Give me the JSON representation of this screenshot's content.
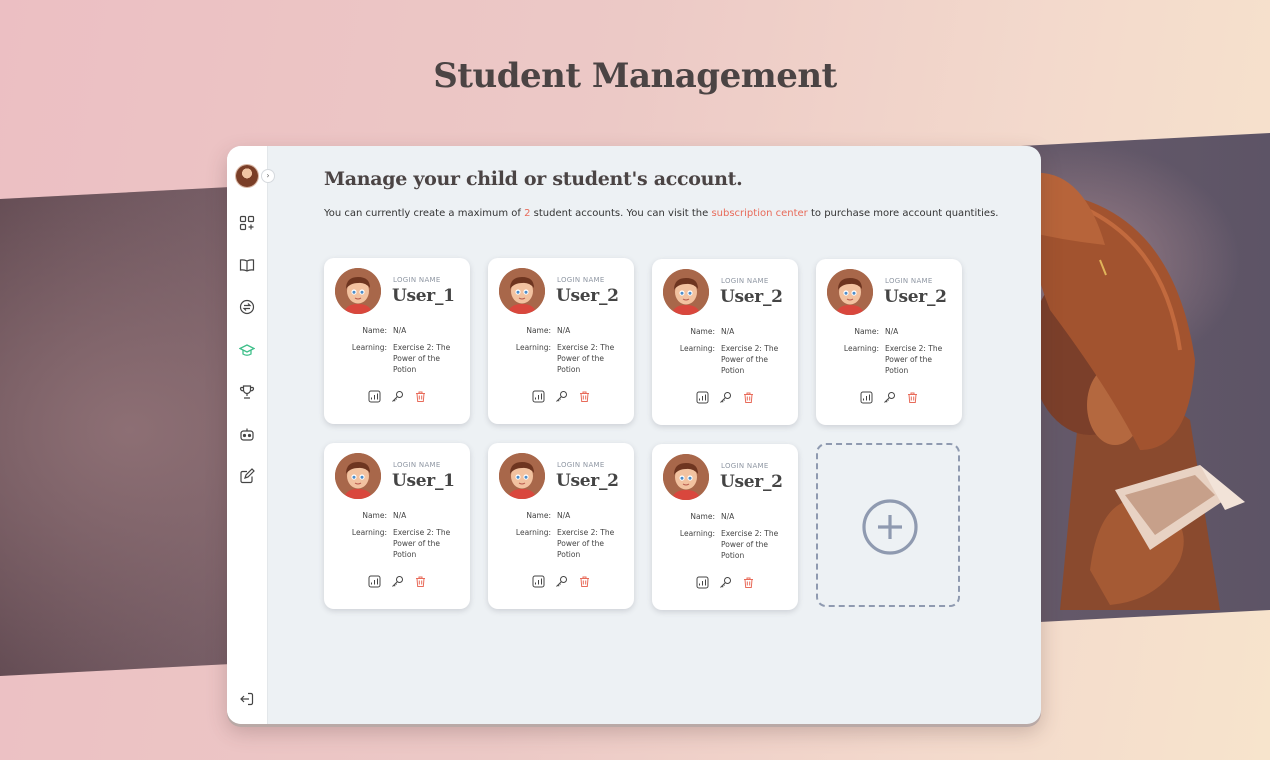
{
  "page": {
    "title": "Student Management"
  },
  "panel": {
    "heading": "Manage your child or student's account.",
    "notice_prefix": "You can currently create a maximum of ",
    "max_accounts": "2",
    "notice_mid": " student accounts. You can visit the ",
    "subscription_link": "subscription center",
    "notice_suffix": " to purchase more account quantities."
  },
  "sidebar": {
    "toggle_glyph": "›",
    "items": [
      {
        "name": "apps-add-icon",
        "active": false
      },
      {
        "name": "book-icon",
        "active": false
      },
      {
        "name": "exchange-icon",
        "active": false
      },
      {
        "name": "graduation-cap-icon",
        "active": true
      },
      {
        "name": "trophy-icon",
        "active": false
      },
      {
        "name": "robot-icon",
        "active": false
      },
      {
        "name": "edit-icon",
        "active": false
      }
    ],
    "logout_icon": "logout-icon"
  },
  "colors": {
    "accent": "#e86b5a",
    "active_icon": "#3fbf8a",
    "icon": "#444444",
    "dashed_border": "#8f9ab0"
  },
  "cards": [
    {
      "login_label": "LOGIN NAME",
      "username": "User_1",
      "name_label": "Name:",
      "name": "N/A",
      "learning_label": "Learning:",
      "learning": "Exercise 2: The Power of the Potion"
    },
    {
      "login_label": "LOGIN NAME",
      "username": "User_2",
      "name_label": "Name:",
      "name": "N/A",
      "learning_label": "Learning:",
      "learning": "Exercise 2: The Power of the Potion"
    },
    {
      "login_label": "LOGIN NAME",
      "username": "User_2",
      "name_label": "Name:",
      "name": "N/A",
      "learning_label": "Learning:",
      "learning": "Exercise 2: The Power of the Potion"
    },
    {
      "login_label": "LOGIN NAME",
      "username": "User_2",
      "name_label": "Name:",
      "name": "N/A",
      "learning_label": "Learning:",
      "learning": "Exercise 2: The Power of the Potion"
    },
    {
      "login_label": "LOGIN NAME",
      "username": "User_1",
      "name_label": "Name:",
      "name": "N/A",
      "learning_label": "Learning:",
      "learning": "Exercise 2: The Power of the Potion"
    },
    {
      "login_label": "LOGIN NAME",
      "username": "User_2",
      "name_label": "Name:",
      "name": "N/A",
      "learning_label": "Learning:",
      "learning": "Exercise 2: The Power of the Potion"
    },
    {
      "login_label": "LOGIN NAME",
      "username": "User_2",
      "name_label": "Name:",
      "name": "N/A",
      "learning_label": "Learning:",
      "learning": "Exercise 2: The Power of the Potion"
    }
  ],
  "card_actions": [
    "chart-icon",
    "key-icon",
    "trash-icon"
  ],
  "add_card": {
    "icon": "plus-circle-icon"
  }
}
